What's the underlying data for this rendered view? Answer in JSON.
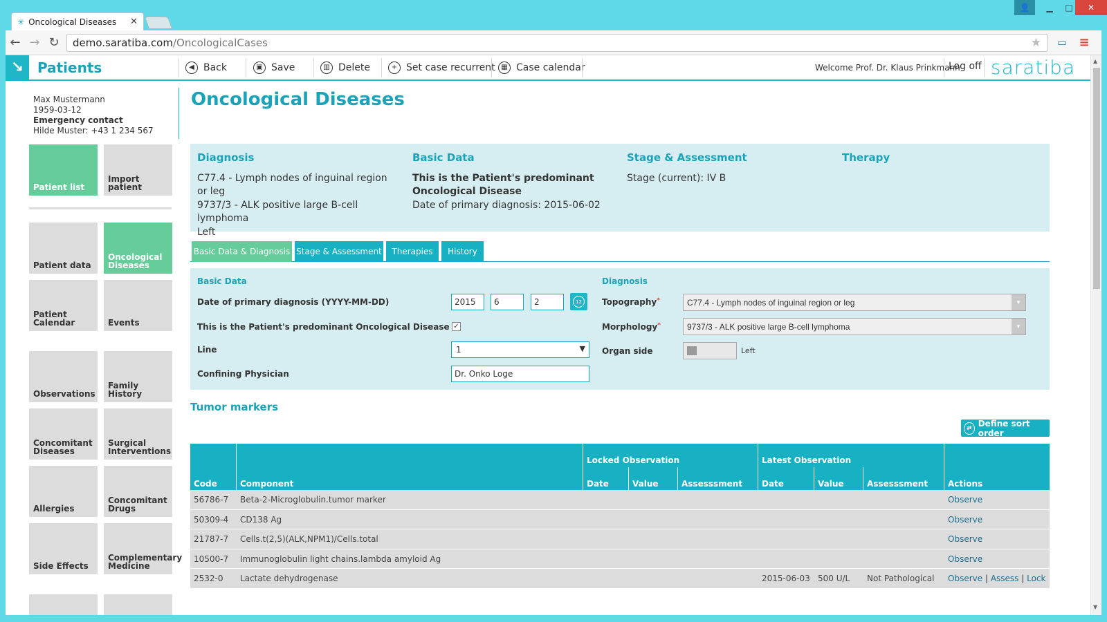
{
  "browser": {
    "tab_title": "Oncological Diseases",
    "tab_favicon_icon": "saratiba-favicon",
    "url_host": "demo.saratiba.com",
    "url_path": "/OncologicalCases"
  },
  "topnav": {
    "module_title": "Patients",
    "buttons": {
      "back": "Back",
      "save": "Save",
      "delete": "Delete",
      "set_recurrent": "Set case recurrent",
      "case_calendar": "Case calendar"
    },
    "welcome": "Welcome Prof. Dr. Klaus Prinkmann",
    "logoff": "Log off",
    "brand": "saratiba"
  },
  "patient": {
    "name": "Max Mustermann",
    "birthdate": "1959-03-12",
    "emergency_label": "Emergency contact",
    "emergency_contact": "Hilde Muster: +43 1 234 567"
  },
  "sidebar": {
    "tiles": [
      {
        "label": "Patient list"
      },
      {
        "label": "Import patient"
      },
      {
        "label": "Patient data"
      },
      {
        "label": "Oncological Diseases"
      },
      {
        "label": "Patient Calendar"
      },
      {
        "label": "Events"
      },
      {
        "label": "Observations"
      },
      {
        "label": "Family History"
      },
      {
        "label": "Concomitant Diseases"
      },
      {
        "label": "Surgical Interventions"
      },
      {
        "label": "Allergies"
      },
      {
        "label": "Concomitant Drugs"
      },
      {
        "label": "Side Effects"
      },
      {
        "label": "Complementary Medicine"
      }
    ]
  },
  "page": {
    "title": "Oncological Diseases"
  },
  "summary": {
    "diagnosis": {
      "heading": "Diagnosis",
      "line1": "C77.4 - Lymph nodes of inguinal region or leg",
      "line2": "9737/3 - ALK positive large B-cell lymphoma",
      "line3": "Left"
    },
    "basic_data": {
      "heading": "Basic Data",
      "line1": "This is the Patient's predominant Oncological Disease",
      "line2": "Date of primary diagnosis: 2015-06-02"
    },
    "stage": {
      "heading": "Stage & Assessment",
      "line1": "Stage (current): IV B"
    },
    "therapy": {
      "heading": "Therapy"
    }
  },
  "tabs": [
    {
      "label": "Basic Data & Diagnosis",
      "active": true
    },
    {
      "label": "Stage & Assessment",
      "active": false
    },
    {
      "label": "Therapies",
      "active": false
    },
    {
      "label": "History",
      "active": false
    }
  ],
  "form": {
    "basic_data_heading": "Basic Data",
    "diagnosis_heading": "Diagnosis",
    "date_label": "Date of primary diagnosis (YYYY-MM-DD)",
    "date_year": "2015",
    "date_month": "6",
    "date_day": "2",
    "predominant_label": "This is the Patient's predominant Oncological Disease",
    "predominant_checked": true,
    "line_label": "Line",
    "line_value": "1",
    "physician_label": "Confining Physician",
    "physician_value": "Dr. Onko Loge",
    "topography_label": "Topography",
    "topography_value": "C77.4 - Lymph nodes of inguinal region or leg",
    "morphology_label": "Morphology",
    "morphology_value": "9737/3 - ALK positive large B-cell lymphoma",
    "organ_side_label": "Organ side",
    "organ_side_value": "Left"
  },
  "tumor_markers": {
    "title": "Tumor markers",
    "sort_button": "Define sort order",
    "headers": {
      "code": "Code",
      "component": "Component",
      "locked_group": "Locked Observation",
      "latest_group": "Latest Observation",
      "date": "Date",
      "value": "Value",
      "assessment": "Assesssment",
      "actions": "Actions"
    },
    "rows": [
      {
        "code": "56786-7",
        "component": "Beta-2-Microglobulin.tumor marker",
        "latest_date": "",
        "latest_value": "",
        "latest_assessment": "",
        "actions": [
          "Observe"
        ]
      },
      {
        "code": "50309-4",
        "component": "CD138 Ag",
        "latest_date": "",
        "latest_value": "",
        "latest_assessment": "",
        "actions": [
          "Observe"
        ]
      },
      {
        "code": "21787-7",
        "component": "Cells.t(2,5)(ALK,NPM1)/Cells.total",
        "latest_date": "",
        "latest_value": "",
        "latest_assessment": "",
        "actions": [
          "Observe"
        ]
      },
      {
        "code": "10500-7",
        "component": "Immunoglobulin light chains.lambda amyloid Ag",
        "latest_date": "",
        "latest_value": "",
        "latest_assessment": "",
        "actions": [
          "Observe"
        ]
      },
      {
        "code": "2532-0",
        "component": "Lactate dehydrogenase",
        "latest_date": "2015-06-03",
        "latest_value": "500 U/L",
        "latest_assessment": "Not Pathological",
        "actions": [
          "Observe",
          "Assess",
          "Lock"
        ]
      }
    ]
  },
  "colors": {
    "accent": "#1aa3b8",
    "tile_active": "#66cc99",
    "tile_inactive": "#dcdcdc",
    "summary_bg": "#d6eef2",
    "required": "#d9463c"
  }
}
